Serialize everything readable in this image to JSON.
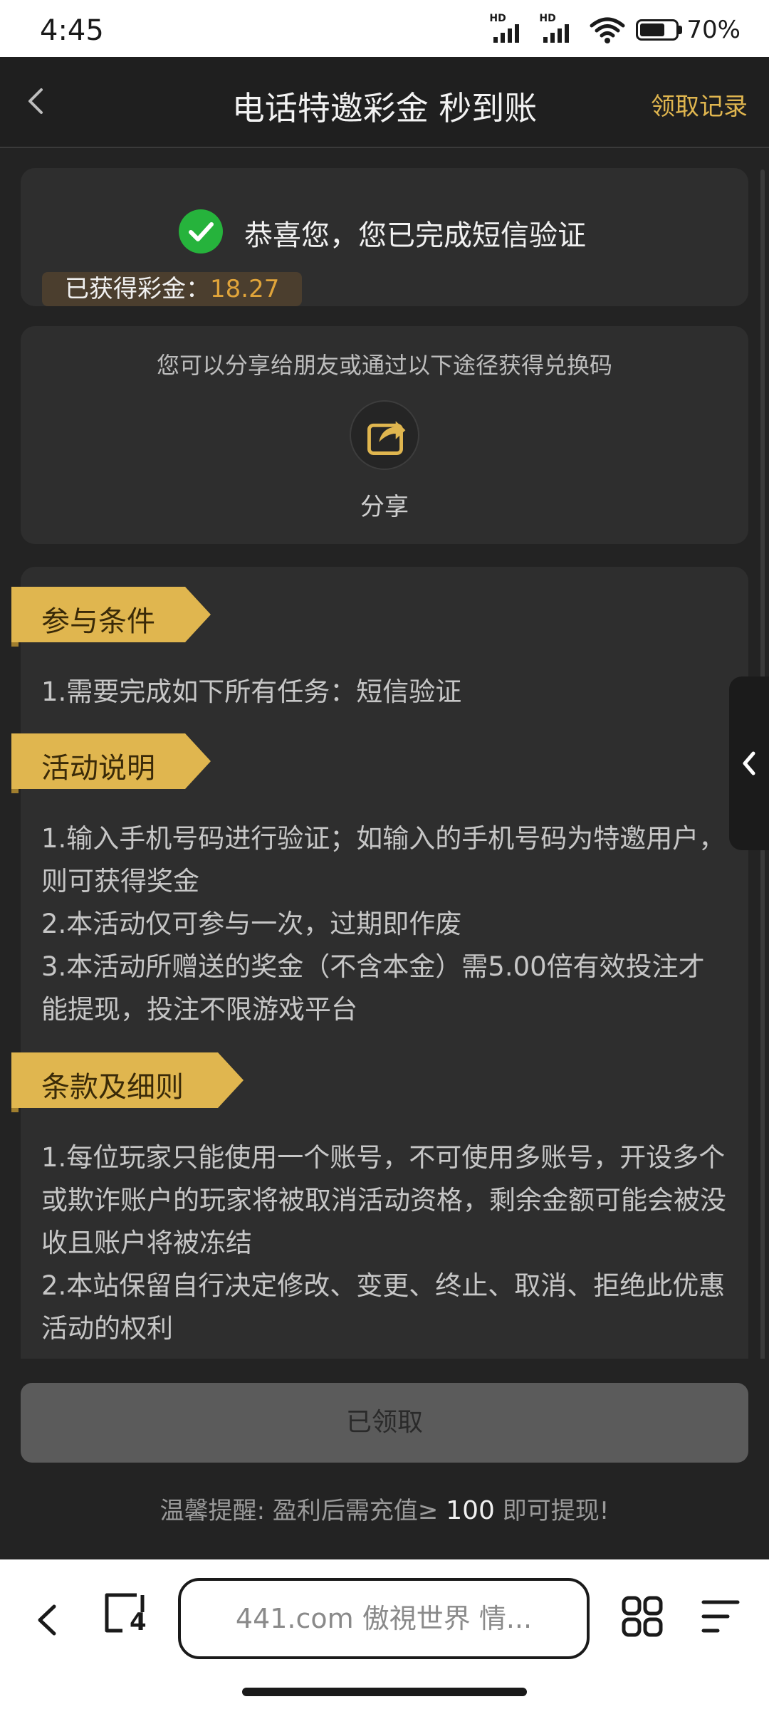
{
  "status": {
    "time": "4:45",
    "hd1": "HD",
    "hd2": "HD",
    "battery_text": "70%",
    "battery_level": 0.7
  },
  "header": {
    "title": "电话特邀彩金 秒到账",
    "records_label": "领取记录"
  },
  "verify_card": {
    "message": "恭喜您，您已完成短信验证",
    "bonus_label": "已获得彩金：",
    "bonus_value": "18.27"
  },
  "share_card": {
    "hint": "您可以分享给朋友或通过以下途径获得兑换码",
    "share_label": "分享"
  },
  "sections": {
    "conditions": {
      "title": "参与条件",
      "lines": [
        "1.需要完成如下所有任务：短信验证"
      ]
    },
    "description": {
      "title": "活动说明",
      "lines": [
        "1.输入手机号码进行验证；如输入的手机号码为特邀用户，则可获得奖金",
        "2.本活动仅可参与一次，过期即作废",
        "3.本活动所赠送的奖金（不含本金）需5.00倍有效投注才能提现，投注不限游戏平台"
      ]
    },
    "terms": {
      "title": "条款及细则",
      "lines": [
        "1.每位玩家只能使用一个账号，不可使用多账号，开设多个或欺诈账户的玩家将被取消活动资格，剩余金额可能会被没收且账户将被冻结",
        "2.本站保留自行决定修改、变更、终止、取消、拒绝此优惠活动的权利"
      ]
    }
  },
  "action": {
    "button_label": "已领取",
    "tip_prefix": "温馨提醒: 盈利后需充值≥ ",
    "tip_amount": "100",
    "tip_suffix": " 即可提现!"
  },
  "browser": {
    "url_text": "441.com 傲視世界 情...",
    "tab_count": "4"
  },
  "colors": {
    "accent_gold": "#e0b64f",
    "success_green": "#26b33c",
    "bonus_orange": "#e0a43a"
  }
}
